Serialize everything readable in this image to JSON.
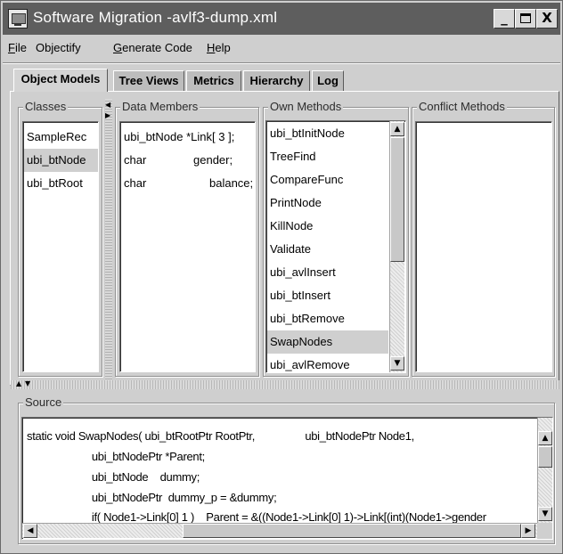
{
  "window": {
    "title": "Software Migration   -avlf3-dump.xml",
    "minimize_label": "_",
    "close_label": "X"
  },
  "menu": [
    {
      "underlined": "F",
      "rest": "ile"
    },
    {
      "underlined": "",
      "rest": "Objectify"
    },
    {
      "underlined": "G",
      "rest": "enerate Code"
    },
    {
      "underlined": "H",
      "rest": "elp"
    }
  ],
  "tabs": [
    "Object Models",
    "Tree Views",
    "Metrics",
    "Hierarchy",
    "Log"
  ],
  "active_tab": "Object Models",
  "classes": {
    "title": "Classes",
    "items": [
      "SampleRec",
      "ubi_btNode",
      "ubi_btRoot"
    ],
    "selected": "ubi_btNode"
  },
  "data_members": {
    "title": "Data Members",
    "rows": [
      {
        "type": "ubi_btNode *Link[ 3 ];",
        "name": ""
      },
      {
        "type": "char",
        "name": "gender;"
      },
      {
        "type": "char",
        "name": "balance;"
      }
    ]
  },
  "own_methods": {
    "title": "Own Methods",
    "items": [
      "ubi_btInitNode",
      "TreeFind",
      "CompareFunc",
      "PrintNode",
      "KillNode",
      "Validate",
      "ubi_avlInsert",
      "ubi_btInsert",
      "ubi_btRemove",
      "SwapNodes",
      "ubi_avlRemove"
    ],
    "selected": "SwapNodes"
  },
  "conflict_methods": {
    "title": "Conflict Methods",
    "items": []
  },
  "source": {
    "title": "Source",
    "lines": [
      "static void SwapNodes( ubi_btRootPtr RootPtr,                 ubi_btNodePtr Node1,",
      "                      ubi_btNodePtr *Parent;",
      "                      ubi_btNode    dummy;",
      "                      ubi_btNodePtr  dummy_p = &dummy;",
      "                      if( Node1->Link[0] 1 )    Parent = &((Node1->Link[0] 1)->Link[(int)(Node1->gender"
    ]
  },
  "icons": {
    "up_arrow": "▲",
    "down_arrow": "▼",
    "left_arrow": "◀",
    "right_arrow": "▶"
  }
}
